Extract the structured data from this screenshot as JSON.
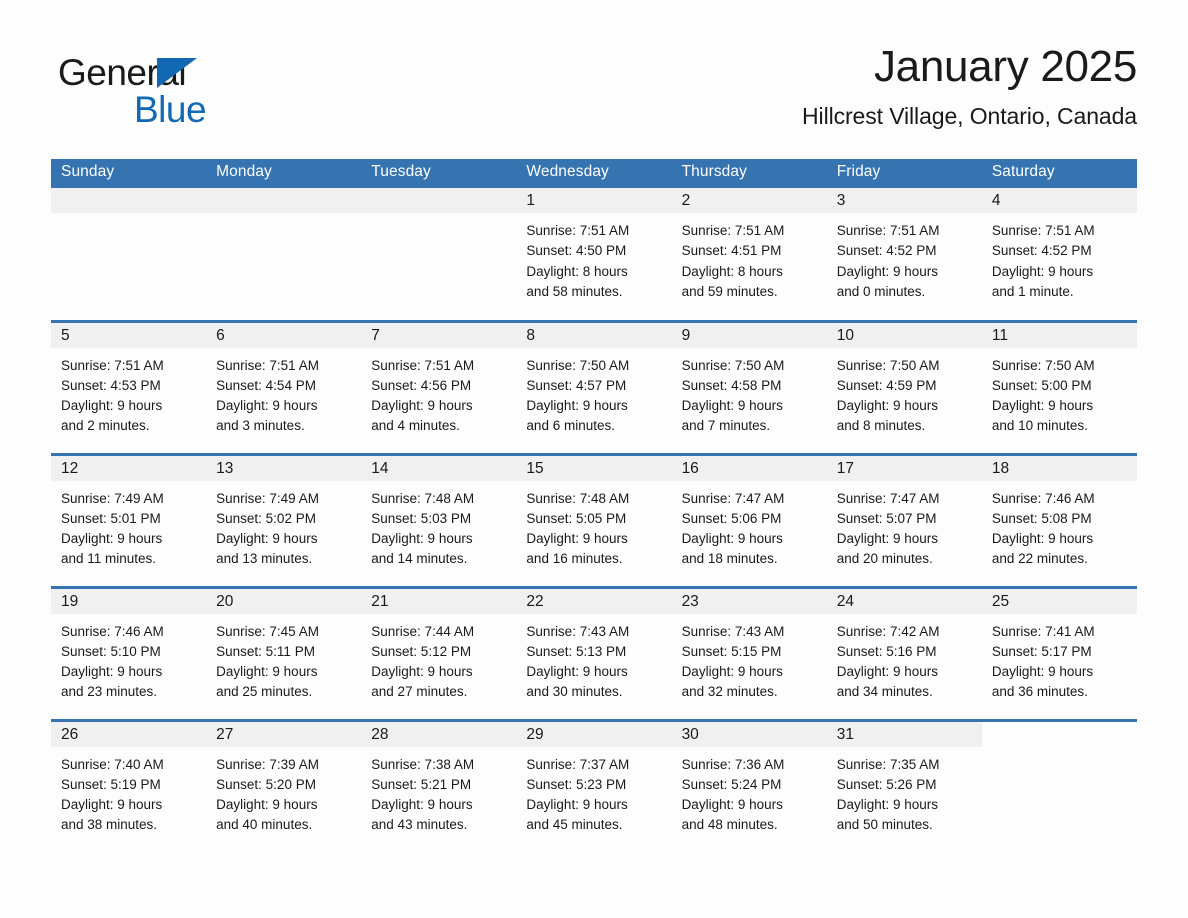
{
  "brand": {
    "word_one": "General",
    "word_two": "Blue",
    "triangle_icon": "brand-triangle-icon"
  },
  "header": {
    "title": "January 2025",
    "subtitle": "Hillcrest Village, Ontario, Canada"
  },
  "colors": {
    "header_blue": "#3573b1",
    "brand_blue": "#1268b3",
    "daynum_background": "#f0f0f0",
    "page_background": "#fdfdfd",
    "text": "#1a1a1a"
  },
  "weekdays": [
    "Sunday",
    "Monday",
    "Tuesday",
    "Wednesday",
    "Thursday",
    "Friday",
    "Saturday"
  ],
  "weeks": [
    [
      {
        "day": "",
        "sunrise": "",
        "sunset": "",
        "daylight_line1": "",
        "daylight_line2": "",
        "blank": true
      },
      {
        "day": "",
        "sunrise": "",
        "sunset": "",
        "daylight_line1": "",
        "daylight_line2": "",
        "blank": true
      },
      {
        "day": "",
        "sunrise": "",
        "sunset": "",
        "daylight_line1": "",
        "daylight_line2": "",
        "blank": true
      },
      {
        "day": "1",
        "sunrise": "Sunrise: 7:51 AM",
        "sunset": "Sunset: 4:50 PM",
        "daylight_line1": "Daylight: 8 hours",
        "daylight_line2": "and 58 minutes."
      },
      {
        "day": "2",
        "sunrise": "Sunrise: 7:51 AM",
        "sunset": "Sunset: 4:51 PM",
        "daylight_line1": "Daylight: 8 hours",
        "daylight_line2": "and 59 minutes."
      },
      {
        "day": "3",
        "sunrise": "Sunrise: 7:51 AM",
        "sunset": "Sunset: 4:52 PM",
        "daylight_line1": "Daylight: 9 hours",
        "daylight_line2": "and 0 minutes."
      },
      {
        "day": "4",
        "sunrise": "Sunrise: 7:51 AM",
        "sunset": "Sunset: 4:52 PM",
        "daylight_line1": "Daylight: 9 hours",
        "daylight_line2": "and 1 minute."
      }
    ],
    [
      {
        "day": "5",
        "sunrise": "Sunrise: 7:51 AM",
        "sunset": "Sunset: 4:53 PM",
        "daylight_line1": "Daylight: 9 hours",
        "daylight_line2": "and 2 minutes."
      },
      {
        "day": "6",
        "sunrise": "Sunrise: 7:51 AM",
        "sunset": "Sunset: 4:54 PM",
        "daylight_line1": "Daylight: 9 hours",
        "daylight_line2": "and 3 minutes."
      },
      {
        "day": "7",
        "sunrise": "Sunrise: 7:51 AM",
        "sunset": "Sunset: 4:56 PM",
        "daylight_line1": "Daylight: 9 hours",
        "daylight_line2": "and 4 minutes."
      },
      {
        "day": "8",
        "sunrise": "Sunrise: 7:50 AM",
        "sunset": "Sunset: 4:57 PM",
        "daylight_line1": "Daylight: 9 hours",
        "daylight_line2": "and 6 minutes."
      },
      {
        "day": "9",
        "sunrise": "Sunrise: 7:50 AM",
        "sunset": "Sunset: 4:58 PM",
        "daylight_line1": "Daylight: 9 hours",
        "daylight_line2": "and 7 minutes."
      },
      {
        "day": "10",
        "sunrise": "Sunrise: 7:50 AM",
        "sunset": "Sunset: 4:59 PM",
        "daylight_line1": "Daylight: 9 hours",
        "daylight_line2": "and 8 minutes."
      },
      {
        "day": "11",
        "sunrise": "Sunrise: 7:50 AM",
        "sunset": "Sunset: 5:00 PM",
        "daylight_line1": "Daylight: 9 hours",
        "daylight_line2": "and 10 minutes."
      }
    ],
    [
      {
        "day": "12",
        "sunrise": "Sunrise: 7:49 AM",
        "sunset": "Sunset: 5:01 PM",
        "daylight_line1": "Daylight: 9 hours",
        "daylight_line2": "and 11 minutes."
      },
      {
        "day": "13",
        "sunrise": "Sunrise: 7:49 AM",
        "sunset": "Sunset: 5:02 PM",
        "daylight_line1": "Daylight: 9 hours",
        "daylight_line2": "and 13 minutes."
      },
      {
        "day": "14",
        "sunrise": "Sunrise: 7:48 AM",
        "sunset": "Sunset: 5:03 PM",
        "daylight_line1": "Daylight: 9 hours",
        "daylight_line2": "and 14 minutes."
      },
      {
        "day": "15",
        "sunrise": "Sunrise: 7:48 AM",
        "sunset": "Sunset: 5:05 PM",
        "daylight_line1": "Daylight: 9 hours",
        "daylight_line2": "and 16 minutes."
      },
      {
        "day": "16",
        "sunrise": "Sunrise: 7:47 AM",
        "sunset": "Sunset: 5:06 PM",
        "daylight_line1": "Daylight: 9 hours",
        "daylight_line2": "and 18 minutes."
      },
      {
        "day": "17",
        "sunrise": "Sunrise: 7:47 AM",
        "sunset": "Sunset: 5:07 PM",
        "daylight_line1": "Daylight: 9 hours",
        "daylight_line2": "and 20 minutes."
      },
      {
        "day": "18",
        "sunrise": "Sunrise: 7:46 AM",
        "sunset": "Sunset: 5:08 PM",
        "daylight_line1": "Daylight: 9 hours",
        "daylight_line2": "and 22 minutes."
      }
    ],
    [
      {
        "day": "19",
        "sunrise": "Sunrise: 7:46 AM",
        "sunset": "Sunset: 5:10 PM",
        "daylight_line1": "Daylight: 9 hours",
        "daylight_line2": "and 23 minutes."
      },
      {
        "day": "20",
        "sunrise": "Sunrise: 7:45 AM",
        "sunset": "Sunset: 5:11 PM",
        "daylight_line1": "Daylight: 9 hours",
        "daylight_line2": "and 25 minutes."
      },
      {
        "day": "21",
        "sunrise": "Sunrise: 7:44 AM",
        "sunset": "Sunset: 5:12 PM",
        "daylight_line1": "Daylight: 9 hours",
        "daylight_line2": "and 27 minutes."
      },
      {
        "day": "22",
        "sunrise": "Sunrise: 7:43 AM",
        "sunset": "Sunset: 5:13 PM",
        "daylight_line1": "Daylight: 9 hours",
        "daylight_line2": "and 30 minutes."
      },
      {
        "day": "23",
        "sunrise": "Sunrise: 7:43 AM",
        "sunset": "Sunset: 5:15 PM",
        "daylight_line1": "Daylight: 9 hours",
        "daylight_line2": "and 32 minutes."
      },
      {
        "day": "24",
        "sunrise": "Sunrise: 7:42 AM",
        "sunset": "Sunset: 5:16 PM",
        "daylight_line1": "Daylight: 9 hours",
        "daylight_line2": "and 34 minutes."
      },
      {
        "day": "25",
        "sunrise": "Sunrise: 7:41 AM",
        "sunset": "Sunset: 5:17 PM",
        "daylight_line1": "Daylight: 9 hours",
        "daylight_line2": "and 36 minutes."
      }
    ],
    [
      {
        "day": "26",
        "sunrise": "Sunrise: 7:40 AM",
        "sunset": "Sunset: 5:19 PM",
        "daylight_line1": "Daylight: 9 hours",
        "daylight_line2": "and 38 minutes."
      },
      {
        "day": "27",
        "sunrise": "Sunrise: 7:39 AM",
        "sunset": "Sunset: 5:20 PM",
        "daylight_line1": "Daylight: 9 hours",
        "daylight_line2": "and 40 minutes."
      },
      {
        "day": "28",
        "sunrise": "Sunrise: 7:38 AM",
        "sunset": "Sunset: 5:21 PM",
        "daylight_line1": "Daylight: 9 hours",
        "daylight_line2": "and 43 minutes."
      },
      {
        "day": "29",
        "sunrise": "Sunrise: 7:37 AM",
        "sunset": "Sunset: 5:23 PM",
        "daylight_line1": "Daylight: 9 hours",
        "daylight_line2": "and 45 minutes."
      },
      {
        "day": "30",
        "sunrise": "Sunrise: 7:36 AM",
        "sunset": "Sunset: 5:24 PM",
        "daylight_line1": "Daylight: 9 hours",
        "daylight_line2": "and 48 minutes."
      },
      {
        "day": "31",
        "sunrise": "Sunrise: 7:35 AM",
        "sunset": "Sunset: 5:26 PM",
        "daylight_line1": "Daylight: 9 hours",
        "daylight_line2": "and 50 minutes."
      },
      {
        "day": "",
        "sunrise": "",
        "sunset": "",
        "daylight_line1": "",
        "daylight_line2": "",
        "outside": true
      }
    ]
  ]
}
